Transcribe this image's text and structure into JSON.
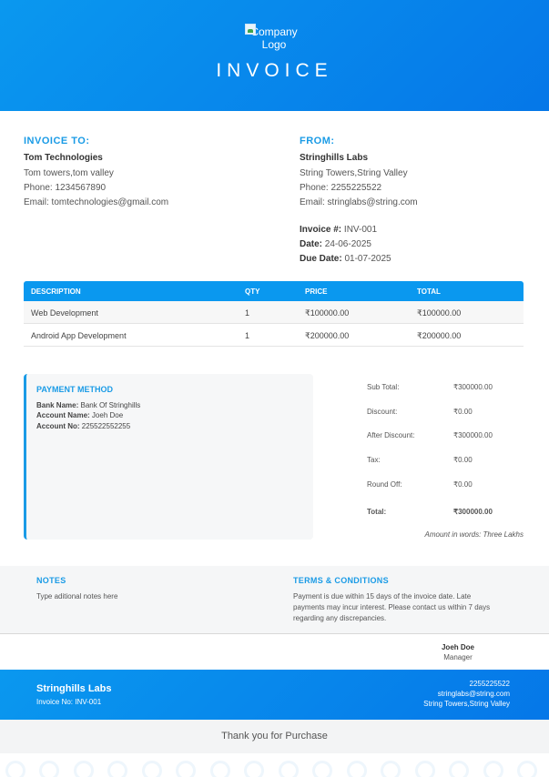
{
  "header": {
    "logo_alt": "Company Logo",
    "title": "INVOICE"
  },
  "invoice_to": {
    "label": "INVOICE TO:",
    "name": "Tom Technologies",
    "address": "Tom towers,tom valley",
    "phone": "Phone: 1234567890",
    "email": "Email: tomtechnologies@gmail.com"
  },
  "from": {
    "label": "FROM:",
    "name": "Stringhills Labs",
    "address": "String Towers,String Valley",
    "phone": "Phone: 2255225522",
    "email": "Email: stringlabs@string.com"
  },
  "meta": {
    "invoice_no_label": "Invoice #:",
    "invoice_no": "INV-001",
    "date_label": "Date:",
    "date": "24-06-2025",
    "due_label": "Due Date:",
    "due": "01-07-2025"
  },
  "items": {
    "headers": [
      "DESCRIPTION",
      "QTY",
      "PRICE",
      "TOTAL"
    ],
    "rows": [
      [
        "Web Development",
        "1",
        "₹100000.00",
        "₹100000.00"
      ],
      [
        "Android App Development",
        "1",
        "₹200000.00",
        "₹200000.00"
      ]
    ]
  },
  "payment": {
    "title": "PAYMENT METHOD",
    "bank_label": "Bank Name:",
    "bank": "Bank Of Stringhills",
    "account_name_label": "Account Name:",
    "account_name": "Joeh Doe",
    "account_no_label": "Account No:",
    "account_no": "225522552255"
  },
  "totals": {
    "subtotal_label": "Sub Total:",
    "subtotal": "₹300000.00",
    "discount_label": "Discount:",
    "discount": "₹0.00",
    "after_discount_label": "After Discount:",
    "after_discount": "₹300000.00",
    "tax_label": "Tax:",
    "tax": "₹0.00",
    "roundoff_label": "Round Off:",
    "roundoff": "₹0.00",
    "total_label": "Total:",
    "total": "₹300000.00",
    "words": "Amount in words: Three Lakhs"
  },
  "notes": {
    "title": "NOTES",
    "text": "Type aditional notes here"
  },
  "terms": {
    "title": "TERMS & CONDITIONS",
    "line1": "Payment is due within 15 days of the invoice date. Late",
    "line2": "payments may incur interest. Please contact us within 7 days",
    "line3": "regarding any discrepancies."
  },
  "signature": {
    "name": "Joeh Doe",
    "role": "Manager"
  },
  "footer": {
    "company": "Stringhills Labs",
    "invoice_no": "Invoice No: INV-001",
    "phone": "2255225522",
    "email": "stringlabs@string.com",
    "address": "String Towers,String Valley"
  },
  "thanks": "Thank you for Purchase",
  "colors": {
    "accent": "#1a9be6",
    "header_start": "#0a98ef",
    "header_end": "#0577e8"
  }
}
